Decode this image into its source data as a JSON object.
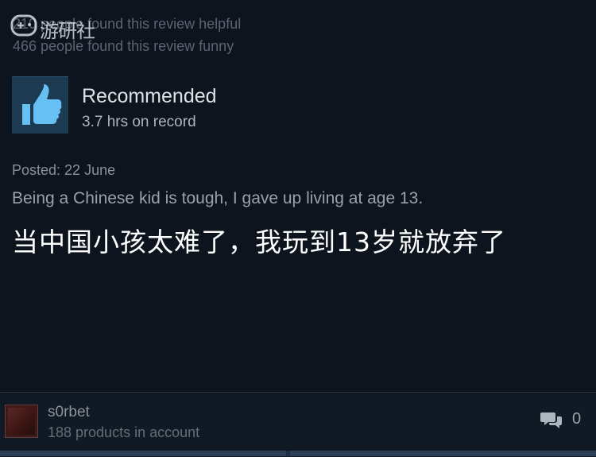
{
  "review": {
    "helpful_text": "210 people found this review helpful",
    "funny_text": "466 people found this review funny",
    "recommendation": "Recommended",
    "hours_on_record": "3.7 hrs on record",
    "posted": "Posted: 22 June",
    "body_en": "Being a Chinese kid is tough, I gave up living at age 13.",
    "body_zh": "当中国小孩太难了，我玩到13岁就放弃了"
  },
  "author": {
    "name": "s0rbet",
    "products": "188 products in account"
  },
  "comments": {
    "count": "0"
  },
  "watermark": {
    "text": "游研社"
  },
  "icons": {
    "thumb": "thumbs-up-icon",
    "comment": "comment-icon",
    "watermark": "gamepad-icon"
  },
  "colors": {
    "background": "#0e141e",
    "thumb_tile": "#1c3a52",
    "thumb_icon": "#66c0f4",
    "zh_text": "#ffffff"
  }
}
